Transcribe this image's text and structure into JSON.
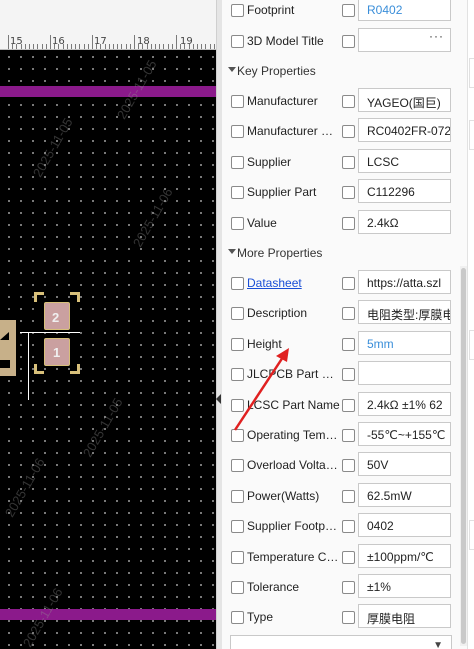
{
  "ruler": {
    "labels": [
      "15",
      "16",
      "17",
      "18",
      "19"
    ]
  },
  "canvas": {
    "pads": [
      {
        "number": "2"
      },
      {
        "number": "1"
      }
    ],
    "annotation_color": "#e02020",
    "watermarks": [
      "2025-11-05",
      "2025-11-05",
      "2025-11-06",
      "2025-11-06",
      "2025-11-05",
      "2025-11-06"
    ]
  },
  "panel": {
    "top_rows": [
      {
        "label": "Footprint",
        "value": "R0402",
        "partial": true
      },
      {
        "label": "3D Model Title",
        "value": "",
        "more": "···"
      }
    ],
    "key_properties": {
      "title": "Key Properties",
      "rows": [
        {
          "label": "Manufacturer",
          "value": "YAGEO(国巨)"
        },
        {
          "label": "Manufacturer Part",
          "value": "RC0402FR-072"
        },
        {
          "label": "Supplier",
          "value": "LCSC"
        },
        {
          "label": "Supplier Part",
          "value": "C112296"
        },
        {
          "label": "Value",
          "value": "2.4kΩ"
        }
      ]
    },
    "more_properties": {
      "title": "More Properties",
      "rows": [
        {
          "label": "Datasheet",
          "value": "https://atta.szl",
          "link": true
        },
        {
          "label": "Description",
          "value": "电阻类型:厚膜电"
        },
        {
          "label": "Height",
          "value": "5mm",
          "unit": true
        },
        {
          "label": "JLCPCB Part Cl...",
          "value": ""
        },
        {
          "label": "LCSC Part Name",
          "value": "2.4kΩ ±1% 62"
        },
        {
          "label": "Operating Temp...",
          "value": "-55℃~+155℃"
        },
        {
          "label": "Overload Voltag...",
          "value": "50V"
        },
        {
          "label": "Power(Watts)",
          "value": "62.5mW"
        },
        {
          "label": "Supplier Footprint",
          "value": "0402"
        },
        {
          "label": "Temperature Co...",
          "value": "±100ppm/℃"
        },
        {
          "label": "Tolerance",
          "value": "±1%"
        },
        {
          "label": "Type",
          "value": "厚膜电阻"
        }
      ]
    }
  }
}
